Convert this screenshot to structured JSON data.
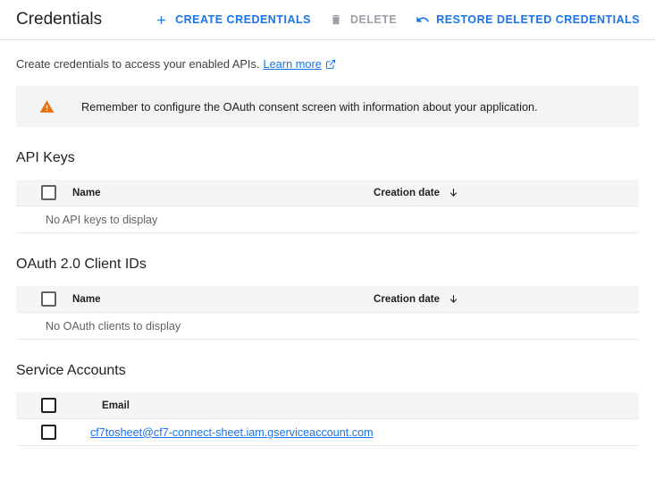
{
  "header": {
    "title": "Credentials",
    "actions": [
      {
        "label": "CREATE CREDENTIALS",
        "icon": "plus-icon",
        "state": "enabled"
      },
      {
        "label": "DELETE",
        "icon": "trash-icon",
        "state": "disabled"
      },
      {
        "label": "RESTORE DELETED CREDENTIALS",
        "icon": "undo-icon",
        "state": "enabled"
      }
    ]
  },
  "subtitle": {
    "text": "Create credentials to access your enabled APIs.",
    "link_label": "Learn more",
    "link_icon": "external-link-icon"
  },
  "banner": {
    "icon": "warning-triangle-icon",
    "text": "Remember to configure the OAuth consent screen with information about your application."
  },
  "sections": [
    {
      "title": "API Keys",
      "columns": [
        "Name",
        "Creation date"
      ],
      "sort_column": "Creation date",
      "sort_direction": "desc",
      "empty_message": "No API keys to display",
      "rows": []
    },
    {
      "title": "OAuth 2.0 Client IDs",
      "columns": [
        "Name",
        "Creation date"
      ],
      "sort_column": "Creation date",
      "sort_direction": "desc",
      "empty_message": "No OAuth clients to display",
      "rows": []
    },
    {
      "title": "Service Accounts",
      "columns": [
        "Email"
      ],
      "empty_message": "",
      "rows": [
        {
          "email": "cf7tosheet@cf7-connect-sheet.iam.gserviceaccount.com"
        }
      ]
    }
  ],
  "colors": {
    "link": "#1a73e8",
    "disabled": "#9aa0a6",
    "warning": "#e8710a",
    "banner_bg": "#f1f3f4",
    "table_head_bg": "#f5f5f5"
  }
}
